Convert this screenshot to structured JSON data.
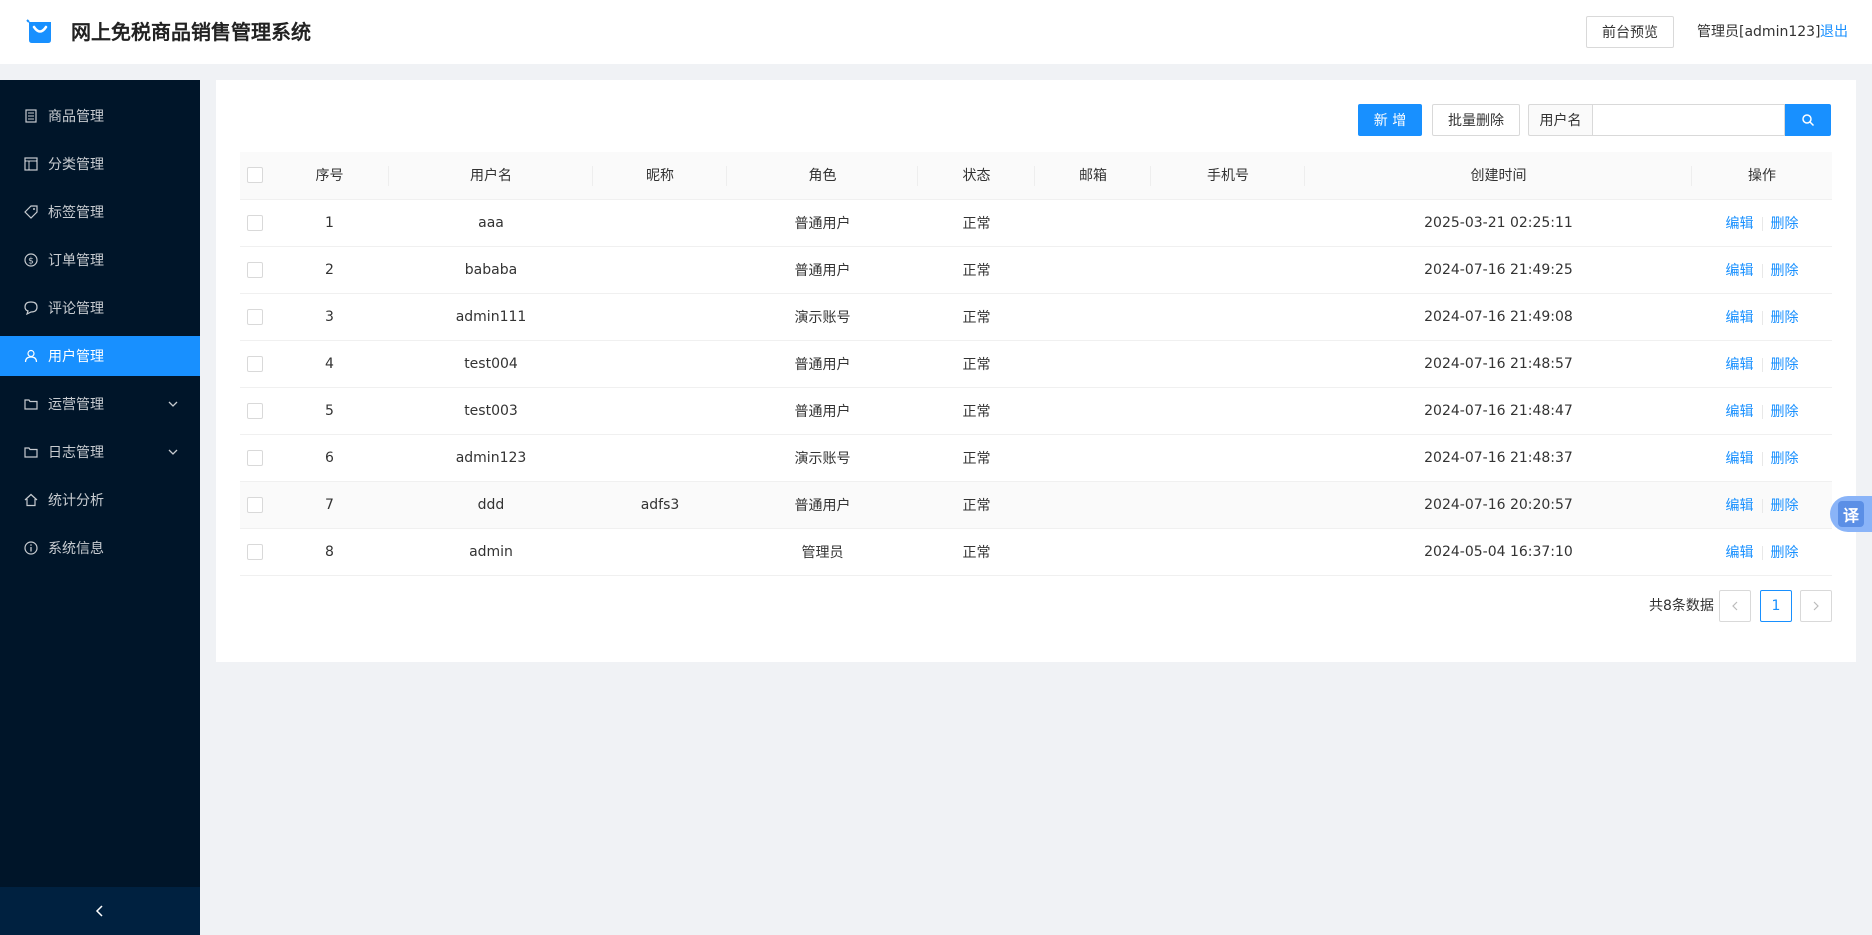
{
  "header": {
    "title": "网上免税商品销售管理系统",
    "preview_label": "前台预览",
    "admin_label": "管理员[admin123]",
    "logout_label": "退出",
    "brand_color": "#1890ff"
  },
  "sidebar": {
    "items": [
      {
        "label": "商品管理",
        "icon": "file-list-icon"
      },
      {
        "label": "分类管理",
        "icon": "layout-icon"
      },
      {
        "label": "标签管理",
        "icon": "tag-icon"
      },
      {
        "label": "订单管理",
        "icon": "dollar-circle-icon"
      },
      {
        "label": "评论管理",
        "icon": "comment-icon"
      },
      {
        "label": "用户管理",
        "icon": "user-icon",
        "active": true
      },
      {
        "label": "运营管理",
        "icon": "folder-icon",
        "submenu": true
      },
      {
        "label": "日志管理",
        "icon": "folder-icon",
        "submenu": true
      },
      {
        "label": "统计分析",
        "icon": "home-icon"
      },
      {
        "label": "系统信息",
        "icon": "info-circle-icon"
      }
    ]
  },
  "toolbar": {
    "add_label": "新 增",
    "batch_delete_label": "批量删除",
    "search_addon": "用户名",
    "search_placeholder": ""
  },
  "table": {
    "columns": [
      "序号",
      "用户名",
      "昵称",
      "角色",
      "状态",
      "邮箱",
      "手机号",
      "创建时间",
      "操作"
    ],
    "rows": [
      {
        "no": "1",
        "username": "aaa",
        "nickname": "",
        "role": "普通用户",
        "status": "正常",
        "email": "",
        "phone": "",
        "created": "2025-03-21 02:25:11"
      },
      {
        "no": "2",
        "username": "bababa",
        "nickname": "",
        "role": "普通用户",
        "status": "正常",
        "email": "",
        "phone": "",
        "created": "2024-07-16 21:49:25"
      },
      {
        "no": "3",
        "username": "admin111",
        "nickname": "",
        "role": "演示账号",
        "status": "正常",
        "email": "",
        "phone": "",
        "created": "2024-07-16 21:49:08"
      },
      {
        "no": "4",
        "username": "test004",
        "nickname": "",
        "role": "普通用户",
        "status": "正常",
        "email": "",
        "phone": "",
        "created": "2024-07-16 21:48:57"
      },
      {
        "no": "5",
        "username": "test003",
        "nickname": "",
        "role": "普通用户",
        "status": "正常",
        "email": "",
        "phone": "",
        "created": "2024-07-16 21:48:47"
      },
      {
        "no": "6",
        "username": "admin123",
        "nickname": "",
        "role": "演示账号",
        "status": "正常",
        "email": "",
        "phone": "",
        "created": "2024-07-16 21:48:37"
      },
      {
        "no": "7",
        "username": "ddd",
        "nickname": "adfs3",
        "role": "普通用户",
        "status": "正常",
        "email": "",
        "phone": "",
        "created": "2024-07-16 20:20:57"
      },
      {
        "no": "8",
        "username": "admin",
        "nickname": "",
        "role": "管理员",
        "status": "正常",
        "email": "",
        "phone": "",
        "created": "2024-05-04 16:37:10"
      }
    ],
    "edit_label": "编辑",
    "delete_label": "删除"
  },
  "pagination": {
    "total_label": "共8条数据",
    "current_page": "1"
  },
  "translate_fab": {
    "label": "译"
  }
}
